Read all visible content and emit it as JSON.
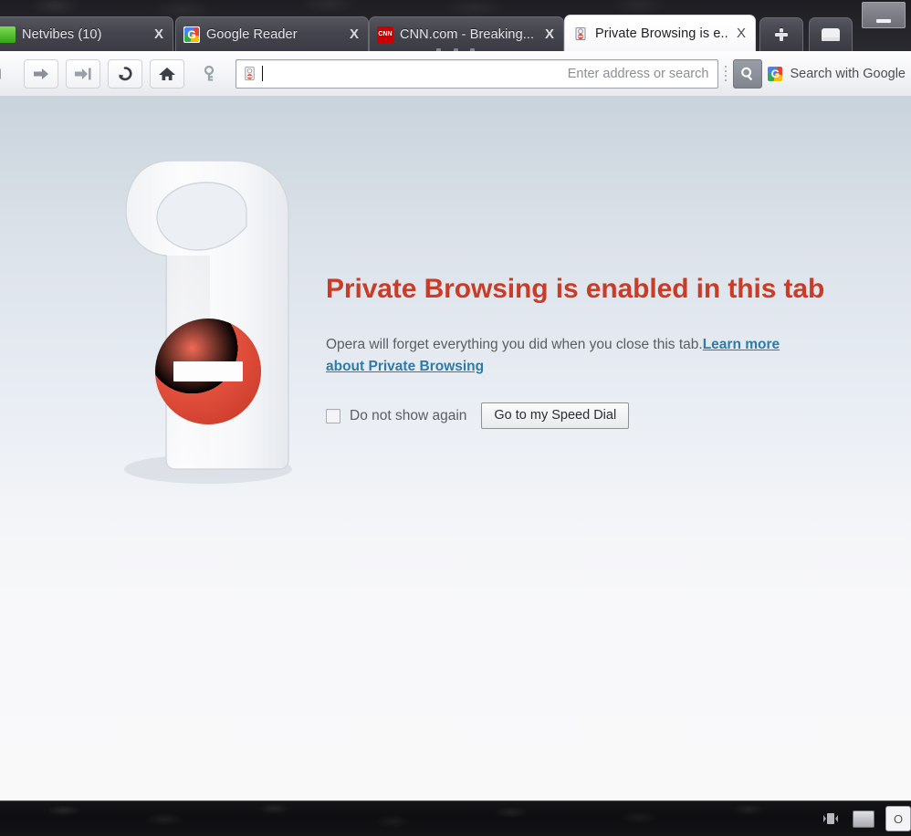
{
  "window": {
    "minimize_label": "Minimize"
  },
  "tabs": [
    {
      "label": "Netvibes (10)",
      "favicon": "netvibes-icon",
      "active": false,
      "close_label": "X"
    },
    {
      "label": "Google Reader",
      "favicon": "google-icon",
      "active": false,
      "close_label": "X"
    },
    {
      "label": "CNN.com - Breaking...",
      "favicon": "cnn-icon",
      "active": false,
      "close_label": "X"
    },
    {
      "label": "Private Browsing is e...",
      "favicon": "door-hanger-icon",
      "active": true,
      "close_label": "X"
    }
  ],
  "tab_controls": {
    "new_tab_label": "+",
    "new_tab_icon": "plus-icon",
    "panel_icon": "panel-toggle-icon"
  },
  "toolbar": {
    "buttons": [
      {
        "name": "back-button",
        "icon": "arrow-left-icon"
      },
      {
        "name": "forward-button",
        "icon": "arrow-right-icon"
      },
      {
        "name": "fast-forward-button",
        "icon": "fast-forward-icon"
      },
      {
        "name": "reload-button",
        "icon": "reload-icon"
      },
      {
        "name": "home-button",
        "icon": "home-icon"
      },
      {
        "name": "wand-button",
        "icon": "key-icon"
      }
    ],
    "address_bar": {
      "value": "",
      "placeholder": "Enter address or search",
      "icon": "door-hanger-icon"
    },
    "search": {
      "grip_icon": "grip-dots-icon",
      "button_icon": "magnifier-icon",
      "engine_icon": "google-icon",
      "label": "Search with Google"
    }
  },
  "page": {
    "illustration": "door-hanger-no-entry-graphic",
    "headline": "Private Browsing is enabled in this tab",
    "body_text": "Opera will forget everything you did when you close this tab.",
    "link_text": "Learn more about Private Browsing",
    "checkbox_label": "Do not show again",
    "checkbox_checked": false,
    "button_label": "Go to my Speed Dial",
    "colors": {
      "headline": "#c83c28",
      "link": "#2e7ba6",
      "body": "#5a5e63",
      "sign_red": "#e04434"
    }
  },
  "taskbar": {
    "tray_icons": [
      "network-icon",
      "display-icon",
      "opera-icon"
    ]
  }
}
